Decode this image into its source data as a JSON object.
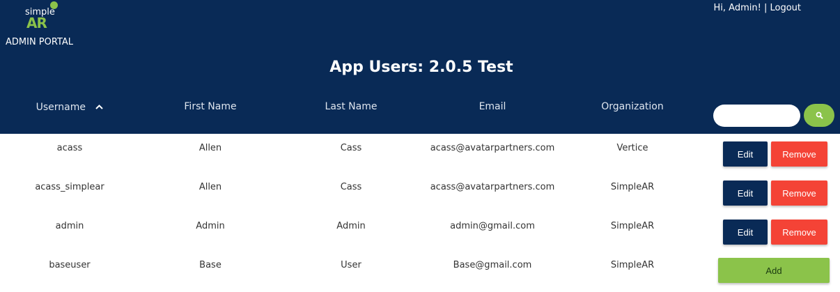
{
  "brand": {
    "logo_small": "simple",
    "logo_main": "AR",
    "portal_label": "ADMIN PORTAL"
  },
  "user_links": {
    "greeting": "Hi, Admin!",
    "separator": "|",
    "logout": "Logout"
  },
  "page": {
    "title": "App Users: 2.0.5 Test"
  },
  "columns": {
    "username": "Username",
    "first_name": "First Name",
    "last_name": "Last Name",
    "email": "Email",
    "organization": "Organization"
  },
  "sort": {
    "column": "username",
    "direction": "ascending",
    "icon": "chevron-up-icon"
  },
  "search": {
    "placeholder": "",
    "value": "",
    "icon": "search-icon"
  },
  "rows": [
    {
      "username": "acass",
      "first_name": "Allen",
      "last_name": "Cass",
      "email": "acass@avatarpartners.com",
      "organization": "Vertice"
    },
    {
      "username": "acass_simplear",
      "first_name": "Allen",
      "last_name": "Cass",
      "email": "acass@avatarpartners.com",
      "organization": "SimpleAR"
    },
    {
      "username": "admin",
      "first_name": "Admin",
      "last_name": "Admin",
      "email": "admin@gmail.com",
      "organization": "SimpleAR"
    },
    {
      "username": "baseuser",
      "first_name": "Base",
      "last_name": "User",
      "email": "Base@gmail.com",
      "organization": "SimpleAR"
    }
  ],
  "actions": {
    "edit": "Edit",
    "remove": "Remove",
    "add": "Add"
  },
  "colors": {
    "header_bg": "#092a56",
    "accent_green": "#8bc34a",
    "danger_red": "#f44336",
    "edit_navy": "#092a56"
  }
}
